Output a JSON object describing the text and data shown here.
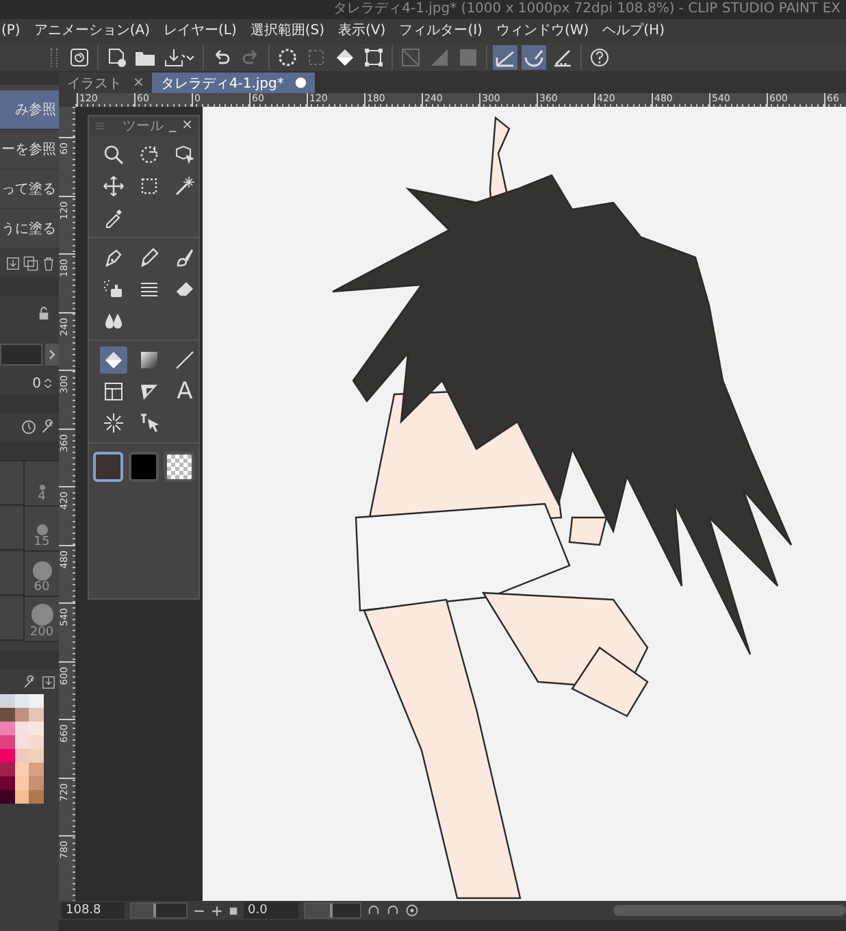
{
  "window": {
    "title": "タレラディ4-1.jpg* (1000 x 1000px 72dpi 108.8%) - CLIP STUDIO PAINT EX"
  },
  "menu": [
    {
      "label": "(P)"
    },
    {
      "label": "アニメーション(A)"
    },
    {
      "label": "レイヤー(L)"
    },
    {
      "label": "選択範囲(S)"
    },
    {
      "label": "表示(V)"
    },
    {
      "label": "フィルター(I)"
    },
    {
      "label": "ウィンドウ(W)"
    },
    {
      "label": "ヘルプ(H)"
    }
  ],
  "toolbar": [
    [
      {
        "kind": "logo",
        "selected": false,
        "disabled": false
      }
    ],
    [
      {
        "kind": "new",
        "selected": false,
        "disabled": false
      },
      {
        "kind": "open",
        "selected": false,
        "disabled": false
      },
      {
        "kind": "export",
        "selected": false,
        "disabled": false
      }
    ],
    [
      {
        "kind": "undo",
        "selected": false,
        "disabled": false
      },
      {
        "kind": "redo",
        "selected": false,
        "disabled": true
      }
    ],
    [
      {
        "kind": "deselect",
        "selected": false,
        "disabled": false
      },
      {
        "kind": "crop",
        "selected": false,
        "disabled": true
      },
      {
        "kind": "fill",
        "selected": false,
        "disabled": false
      },
      {
        "kind": "transform",
        "selected": false,
        "disabled": false
      }
    ],
    [
      {
        "kind": "diagonal",
        "selected": false,
        "disabled": true
      },
      {
        "kind": "halfsquare",
        "selected": false,
        "disabled": true
      },
      {
        "kind": "square",
        "selected": false,
        "disabled": true
      }
    ],
    [
      {
        "kind": "snapruler",
        "selected": true,
        "disabled": false
      },
      {
        "kind": "snapcurve",
        "selected": true,
        "disabled": false
      },
      {
        "kind": "snapgrid",
        "selected": false,
        "disabled": false
      }
    ],
    [
      {
        "kind": "help",
        "selected": false,
        "disabled": false
      }
    ]
  ],
  "left_panel": {
    "subtools": [
      {
        "label": "み参照",
        "selected": true
      },
      {
        "label": "ーを参照",
        "selected": false
      },
      {
        "label": "って塗る",
        "selected": false
      },
      {
        "label": "うに塗る",
        "selected": false
      }
    ],
    "value_field": {
      "value": "0"
    },
    "brush_sizes": [
      {
        "label": "4"
      },
      {
        "label": "15"
      },
      {
        "label": "60"
      },
      {
        "label": "200"
      }
    ],
    "palette": [
      {
        "color": "#d0d4dc"
      },
      {
        "color": "#e4e8ee"
      },
      {
        "color": "#eef0f2"
      },
      {
        "color": "#6a5040"
      },
      {
        "color": "#c09080"
      },
      {
        "color": "#e4c4b4"
      },
      {
        "color": "#f080b0"
      },
      {
        "color": "#f8e0e0"
      },
      {
        "color": "#fae8e0"
      },
      {
        "color": "#e04080"
      },
      {
        "color": "#f6dede"
      },
      {
        "color": "#f8d8c8"
      },
      {
        "color": "#f00060"
      },
      {
        "color": "#f0c8c0"
      },
      {
        "color": "#f0d0b8"
      },
      {
        "color": "#a02050"
      },
      {
        "color": "#f8d0b0"
      },
      {
        "color": "#d8a080"
      },
      {
        "color": "#700030"
      },
      {
        "color": "#f8c8a0"
      },
      {
        "color": "#c89070"
      },
      {
        "color": "#400020"
      },
      {
        "color": "#f0c090"
      },
      {
        "color": "#b07850"
      }
    ]
  },
  "document_tabs": [
    {
      "label": "イラスト",
      "close": "×",
      "selected": false
    },
    {
      "label": "タレラディ4-1.jpg*",
      "close": "●",
      "selected": true
    }
  ],
  "rulers": {
    "horizontal": [
      "120",
      "60",
      "0",
      "60",
      "120",
      "180",
      "240",
      "300",
      "360",
      "420",
      "480",
      "540",
      "600",
      "66"
    ],
    "vertical": [
      "60",
      "120",
      "180",
      "240",
      "300",
      "360",
      "420",
      "480",
      "540",
      "600",
      "660",
      "720",
      "780"
    ]
  },
  "tool_palette": {
    "title": "ツール",
    "minimize": "_",
    "close": "×",
    "groups": [
      [
        {
          "kind": "zoom",
          "selected": false
        },
        {
          "kind": "rotate",
          "selected": false
        },
        {
          "kind": "object",
          "selected": false
        },
        {
          "kind": "move",
          "selected": false
        },
        {
          "kind": "select",
          "selected": false
        },
        {
          "kind": "wand",
          "selected": false
        },
        {
          "kind": "eyedropper",
          "selected": false
        }
      ],
      [
        {
          "kind": "pen",
          "selected": false
        },
        {
          "kind": "pencil",
          "selected": false
        },
        {
          "kind": "brush",
          "selected": false
        },
        {
          "kind": "airbrush",
          "selected": false
        },
        {
          "kind": "decoration",
          "selected": false
        },
        {
          "kind": "eraser",
          "selected": false
        },
        {
          "kind": "blend",
          "selected": false
        }
      ],
      [
        {
          "kind": "fill",
          "selected": true
        },
        {
          "kind": "gradient",
          "selected": false
        },
        {
          "kind": "line",
          "selected": false
        },
        {
          "kind": "frame",
          "selected": false
        },
        {
          "kind": "ruler",
          "selected": false
        },
        {
          "kind": "text",
          "glyph": "A",
          "selected": false
        },
        {
          "kind": "burst",
          "selected": false
        },
        {
          "kind": "cursor",
          "selected": false
        }
      ]
    ],
    "colors": [
      {
        "kind": "solid",
        "color": "#3a332f",
        "selected": true
      },
      {
        "kind": "solid",
        "color": "#000000",
        "selected": false
      },
      {
        "kind": "transparent",
        "selected": false
      }
    ]
  },
  "status_bar": {
    "zoom": "108.8",
    "zoom_slider": {
      "level": 0.45
    },
    "angle": "0.0",
    "angle_slider": {
      "level": 0.5
    }
  }
}
